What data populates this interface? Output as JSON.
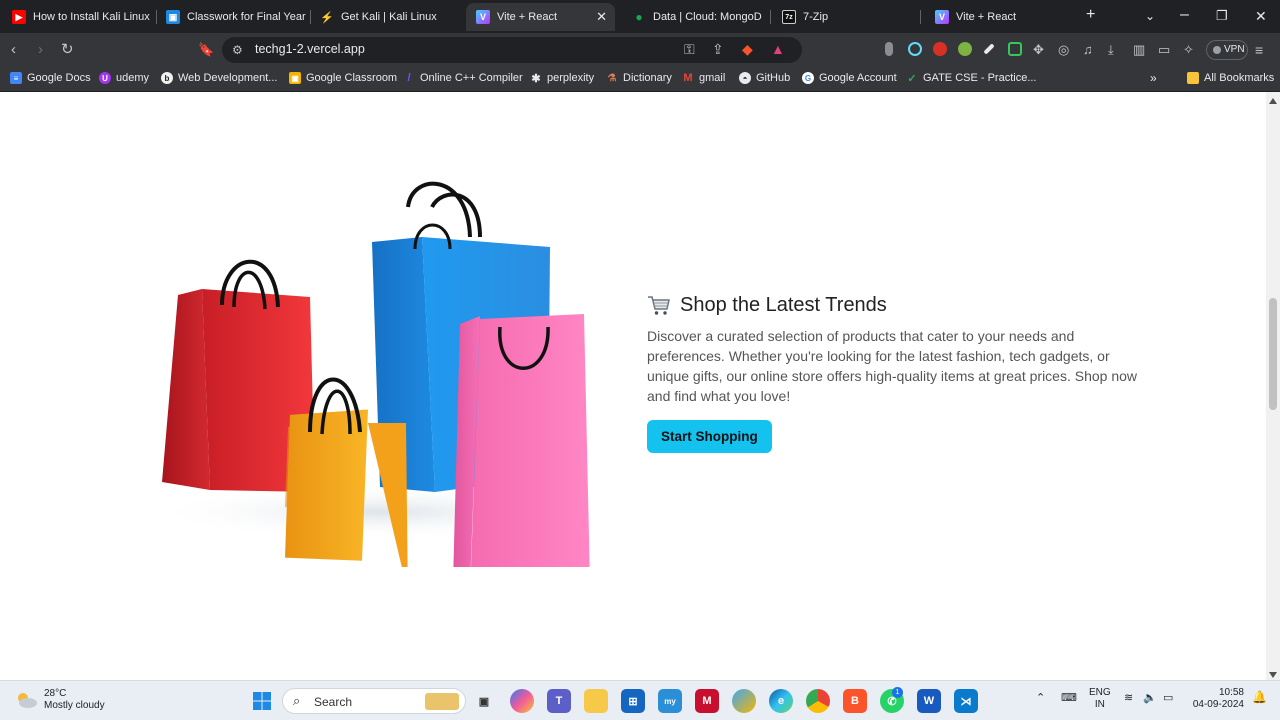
{
  "browser": {
    "tabs": [
      {
        "title": "How to Install Kali Linux in",
        "icon": "youtube-icon",
        "active": false
      },
      {
        "title": "Classwork for Final Year C",
        "icon": "classroom-icon",
        "active": false
      },
      {
        "title": "Get Kali | Kali Linux",
        "icon": "kali-icon",
        "active": false
      },
      {
        "title": "Vite + React",
        "icon": "vite-icon",
        "active": true
      },
      {
        "title": "Data | Cloud: MongoDB C",
        "icon": "mongodb-icon",
        "active": false
      },
      {
        "title": "7-Zip",
        "icon": "7zip-icon",
        "active": false
      },
      {
        "title": "Vite + React",
        "icon": "vite-icon",
        "active": false
      }
    ],
    "url": "techg1-2.vercel.app",
    "vpn_label": "VPN",
    "bookmarks": [
      {
        "label": "Google Docs",
        "icon": "docs-icon"
      },
      {
        "label": "udemy",
        "icon": "udemy-icon"
      },
      {
        "label": "Web Development...",
        "icon": "web-icon"
      },
      {
        "label": "Google Classroom",
        "icon": "classroom-icon"
      },
      {
        "label": "Online C++ Compiler",
        "icon": "compiler-icon"
      },
      {
        "label": "perplexity",
        "icon": "perplexity-icon"
      },
      {
        "label": "Dictionary",
        "icon": "dictionary-icon"
      },
      {
        "label": "gmail",
        "icon": "gmail-icon"
      },
      {
        "label": "GitHub",
        "icon": "github-icon"
      },
      {
        "label": "Google Account",
        "icon": "google-icon"
      },
      {
        "label": "GATE CSE - Practice...",
        "icon": "gate-icon"
      }
    ],
    "all_bookmarks_label": "All Bookmarks"
  },
  "page": {
    "title": "Shop the Latest Trends",
    "description": "Discover a curated selection of products that cater to your needs and preferences. Whether you're looking for the latest fashion, tech gadgets, or unique gifts, our online store offers high-quality items at great prices. Shop now and find what you love!",
    "cta_label": "Start Shopping",
    "colors": {
      "accent": "#14c2f0",
      "bag_red": "#e52f34",
      "bag_yellow": "#fbb624",
      "bag_blue": "#1a8fe0",
      "bag_pink": "#f86cb4"
    }
  },
  "taskbar": {
    "temperature": "28°C",
    "weather": "Mostly cloudy",
    "search_label": "Search",
    "language": "ENG",
    "region": "IN",
    "time": "10:58",
    "date": "04-09-2024",
    "whatsapp_badge": "1"
  }
}
